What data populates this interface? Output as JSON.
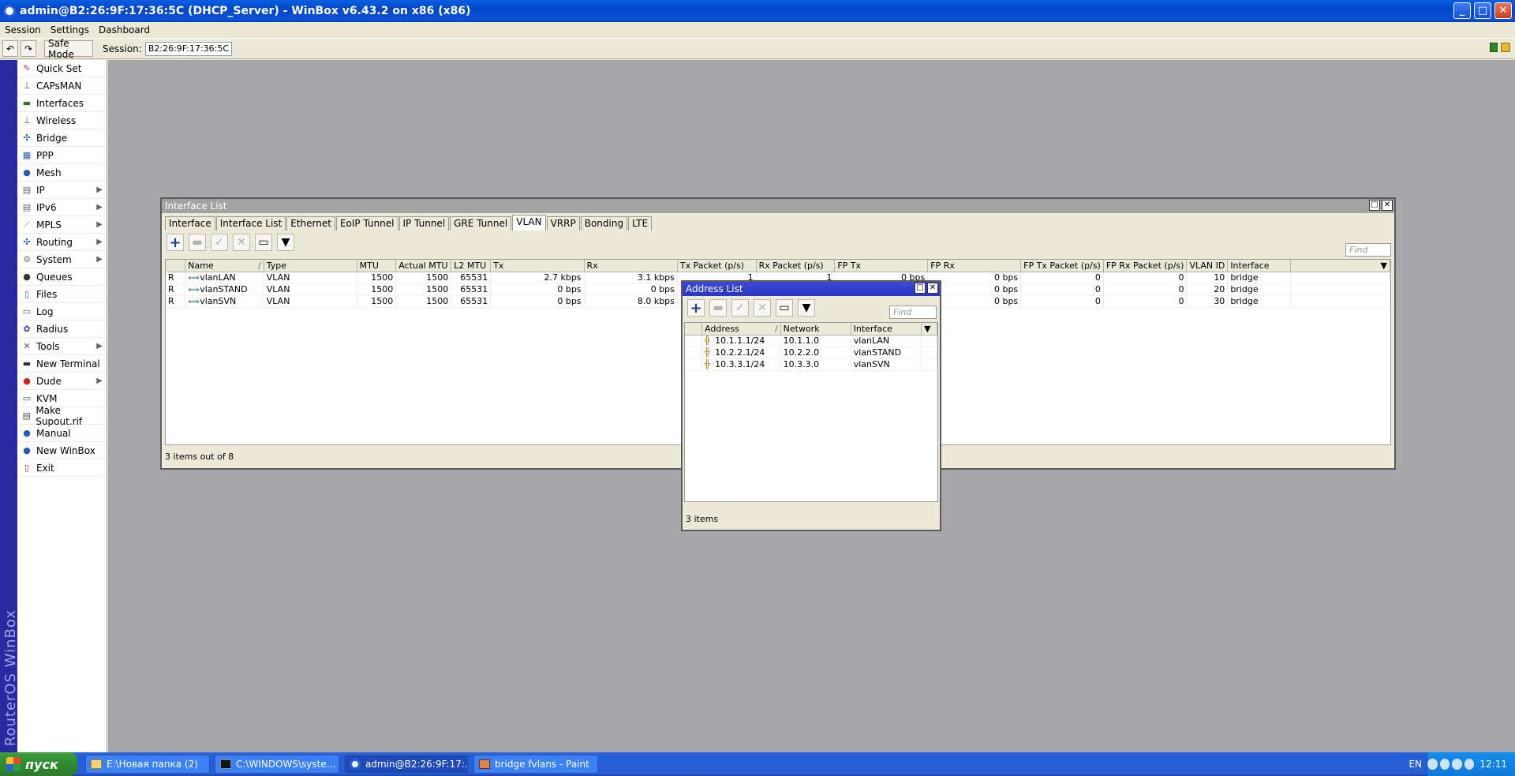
{
  "window": {
    "title": "admin@B2:26:9F:17:36:5C (DHCP_Server) - WinBox v6.43.2 on x86 (x86)",
    "minimize": "_",
    "maximize": "□",
    "close": "✕"
  },
  "menu": [
    "Session",
    "Settings",
    "Dashboard"
  ],
  "toolbar": {
    "undo": "↶",
    "redo": "↷",
    "safe_mode": "Safe Mode",
    "session_label": "Session:",
    "session_value": "B2:26:9F:17:36:5C"
  },
  "vertical_brand": "RouterOS WinBox",
  "sidebar": {
    "items": [
      {
        "label": "Quick Set",
        "icon": "quickset-icon",
        "sub": false
      },
      {
        "label": "CAPsMAN",
        "icon": "capsman-icon",
        "sub": false
      },
      {
        "label": "Interfaces",
        "icon": "interfaces-icon",
        "sub": false
      },
      {
        "label": "Wireless",
        "icon": "wireless-icon",
        "sub": false
      },
      {
        "label": "Bridge",
        "icon": "bridge-icon",
        "sub": false
      },
      {
        "label": "PPP",
        "icon": "ppp-icon",
        "sub": false
      },
      {
        "label": "Mesh",
        "icon": "mesh-icon",
        "sub": false
      },
      {
        "label": "IP",
        "icon": "ip-icon",
        "sub": true
      },
      {
        "label": "IPv6",
        "icon": "ipv6-icon",
        "sub": true
      },
      {
        "label": "MPLS",
        "icon": "mpls-icon",
        "sub": true
      },
      {
        "label": "Routing",
        "icon": "routing-icon",
        "sub": true
      },
      {
        "label": "System",
        "icon": "system-icon",
        "sub": true
      },
      {
        "label": "Queues",
        "icon": "queues-icon",
        "sub": false
      },
      {
        "label": "Files",
        "icon": "files-icon",
        "sub": false
      },
      {
        "label": "Log",
        "icon": "log-icon",
        "sub": false
      },
      {
        "label": "Radius",
        "icon": "radius-icon",
        "sub": false
      },
      {
        "label": "Tools",
        "icon": "tools-icon",
        "sub": true
      },
      {
        "label": "New Terminal",
        "icon": "terminal-icon",
        "sub": false
      },
      {
        "label": "Dude",
        "icon": "dude-icon",
        "sub": true
      },
      {
        "label": "KVM",
        "icon": "kvm-icon",
        "sub": false
      },
      {
        "label": "Make Supout.rif",
        "icon": "supout-icon",
        "sub": false
      },
      {
        "label": "Manual",
        "icon": "manual-icon",
        "sub": false
      },
      {
        "label": "New WinBox",
        "icon": "winbox-icon",
        "sub": false
      },
      {
        "label": "Exit",
        "icon": "exit-icon",
        "sub": false
      }
    ]
  },
  "interface_list": {
    "title": "Interface List",
    "tabs": [
      "Interface",
      "Interface List",
      "Ethernet",
      "EoIP Tunnel",
      "IP Tunnel",
      "GRE Tunnel",
      "VLAN",
      "VRRP",
      "Bonding",
      "LTE"
    ],
    "active_tab": "VLAN",
    "find_placeholder": "Find",
    "columns": [
      "",
      "Name",
      "Type",
      "MTU",
      "Actual MTU",
      "L2 MTU",
      "Tx",
      "Rx",
      "Tx Packet (p/s)",
      "Rx Packet (p/s)",
      "FP Tx",
      "FP Rx",
      "FP Tx Packet (p/s)",
      "FP Rx Packet (p/s)",
      "VLAN ID",
      "Interface"
    ],
    "sort_marker": "/",
    "rows": [
      {
        "flag": "R",
        "name": "vlanLAN",
        "type": "VLAN",
        "mtu": "1500",
        "actual_mtu": "1500",
        "l2_mtu": "65531",
        "tx": "2.7 kbps",
        "rx": "3.1 kbps",
        "tx_pkt": "1",
        "rx_pkt": "1",
        "fp_tx": "0 bps",
        "fp_rx": "0 bps",
        "fp_tx_pkt": "0",
        "fp_rx_pkt": "0",
        "vlan_id": "10",
        "interface": "bridge"
      },
      {
        "flag": "R",
        "name": "vlanSTAND",
        "type": "VLAN",
        "mtu": "1500",
        "actual_mtu": "1500",
        "l2_mtu": "65531",
        "tx": "0 bps",
        "rx": "0 bps",
        "tx_pkt": "",
        "rx_pkt": "",
        "fp_tx": "",
        "fp_rx": "0 bps",
        "fp_tx_pkt": "0",
        "fp_rx_pkt": "0",
        "vlan_id": "20",
        "interface": "bridge"
      },
      {
        "flag": "R",
        "name": "vlanSVN",
        "type": "VLAN",
        "mtu": "1500",
        "actual_mtu": "1500",
        "l2_mtu": "65531",
        "tx": "0 bps",
        "rx": "8.0 kbps",
        "tx_pkt": "",
        "rx_pkt": "",
        "fp_tx": "",
        "fp_rx": "0 bps",
        "fp_tx_pkt": "0",
        "fp_rx_pkt": "0",
        "vlan_id": "30",
        "interface": "bridge"
      }
    ],
    "status": "3 items out of 8"
  },
  "address_list": {
    "title": "Address List",
    "find_placeholder": "Find",
    "columns": [
      "Address",
      "Network",
      "Interface"
    ],
    "sort_marker": "/",
    "rows": [
      {
        "address": "10.1.1.1/24",
        "network": "10.1.1.0",
        "interface": "vlanLAN"
      },
      {
        "address": "10.2.2.1/24",
        "network": "10.2.2.0",
        "interface": "vlanSTAND"
      },
      {
        "address": "10.3.3.1/24",
        "network": "10.3.3.0",
        "interface": "vlanSVN"
      }
    ],
    "status": "3 items"
  },
  "taskbar": {
    "start_label": "пуск",
    "tasks": [
      {
        "label": "E:\\Новая папка (2)",
        "icon": "folder-icon",
        "active": false
      },
      {
        "label": "C:\\WINDOWS\\syste...",
        "icon": "cmd-icon",
        "active": false
      },
      {
        "label": "admin@B2:26:9F:17:...",
        "icon": "winbox-icon",
        "active": true
      },
      {
        "label": "bridge fvlans - Paint",
        "icon": "paint-icon",
        "active": false
      }
    ],
    "lang": "EN",
    "clock": "12:11"
  },
  "colors": {
    "workspace": "#a7a6ab",
    "active_title": "#2a36c4",
    "inactive_title": "#a3a3a3",
    "brand_bar": "#2a2aa0"
  }
}
